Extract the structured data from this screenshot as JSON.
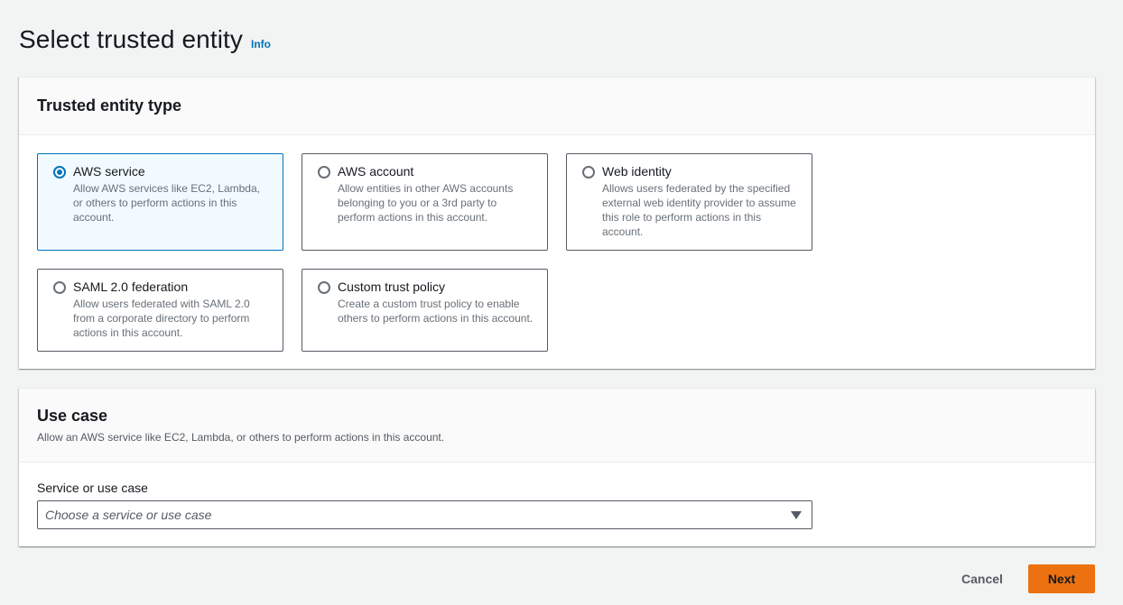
{
  "page": {
    "title": "Select trusted entity",
    "info_link": "Info"
  },
  "trusted_entity": {
    "title": "Trusted entity type",
    "options": [
      {
        "label": "AWS service",
        "description": "Allow AWS services like EC2, Lambda, or others to perform actions in this account.",
        "selected": true
      },
      {
        "label": "AWS account",
        "description": "Allow entities in other AWS accounts belonging to you or a 3rd party to perform actions in this account.",
        "selected": false
      },
      {
        "label": "Web identity",
        "description": "Allows users federated by the specified external web identity provider to assume this role to perform actions in this account.",
        "selected": false
      },
      {
        "label": "SAML 2.0 federation",
        "description": "Allow users federated with SAML 2.0 from a corporate directory to perform actions in this account.",
        "selected": false
      },
      {
        "label": "Custom trust policy",
        "description": "Create a custom trust policy to enable others to perform actions in this account.",
        "selected": false
      }
    ]
  },
  "use_case": {
    "title": "Use case",
    "description": "Allow an AWS service like EC2, Lambda, or others to perform actions in this account.",
    "field_label": "Service or use case",
    "select_placeholder": "Choose a service or use case"
  },
  "footer": {
    "cancel_label": "Cancel",
    "next_label": "Next"
  },
  "colors": {
    "accent": "#0073bb",
    "primary_button": "#ec7211",
    "background": "#f2f3f3"
  }
}
